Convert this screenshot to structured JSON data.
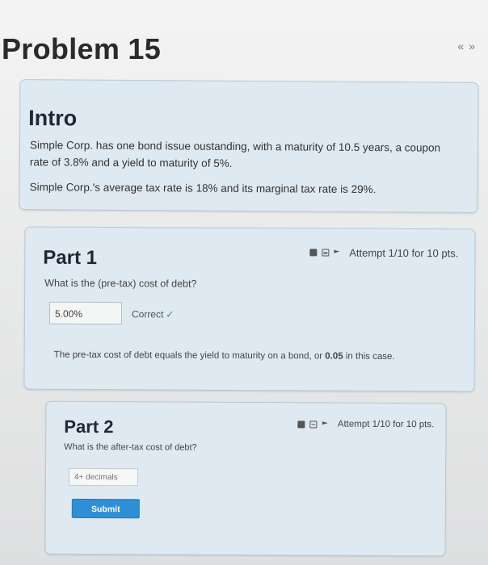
{
  "page": {
    "title": "Problem 15",
    "nav_prev": "«",
    "nav_next": "»"
  },
  "intro": {
    "title": "Intro",
    "paragraph1": "Simple Corp. has one bond issue oustanding, with a maturity of 10.5 years, a coupon rate of 3.8% and a yield to maturity of 5%.",
    "paragraph2": "Simple Corp.'s average tax rate is 18% and its marginal tax rate is 29%."
  },
  "part1": {
    "title": "Part 1",
    "attempt": "Attempt 1/10 for 10 pts.",
    "question": "What is the (pre-tax) cost of debt?",
    "answer_value": "5.00%",
    "status": "Correct",
    "status_mark": "✓",
    "explanation_prefix": "The pre-tax cost of debt equals the yield to maturity on a bond, or ",
    "explanation_value": "0.05",
    "explanation_suffix": " in this case."
  },
  "part2": {
    "title": "Part 2",
    "attempt": "Attempt 1/10 for 10 pts.",
    "question": "What is the after-tax cost of debt?",
    "input_placeholder": "4+ decimals",
    "submit_label": "Submit"
  }
}
